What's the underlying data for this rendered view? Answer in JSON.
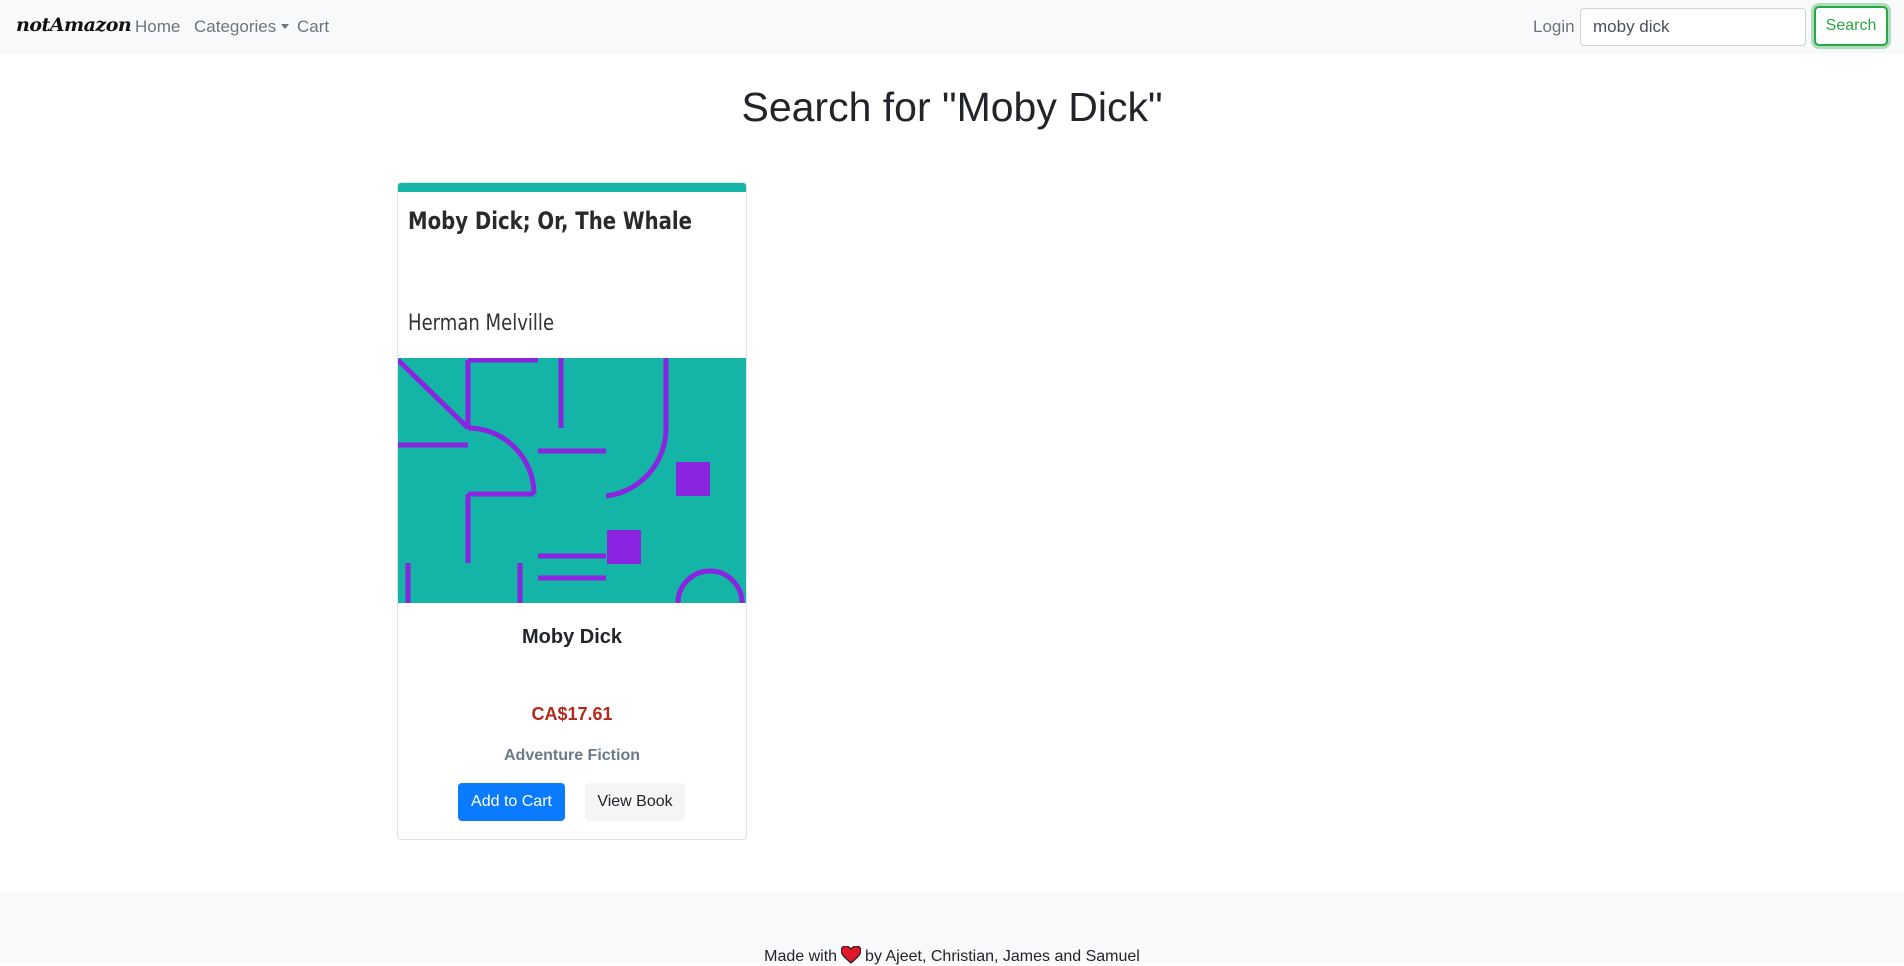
{
  "navbar": {
    "brand": "notAmazon",
    "home": "Home",
    "categories": "Categories",
    "cart": "Cart",
    "login": "Login",
    "search_value": "moby dick",
    "search_button": "Search"
  },
  "main": {
    "heading": "Search for \"Moby Dick\"",
    "results": [
      {
        "cover_title": "Moby Dick; Or, The Whale",
        "cover_author": "Herman Melville",
        "title": "Moby Dick",
        "price": "CA$17.61",
        "genre": "Adventure Fiction",
        "add_button": "Add to Cart",
        "view_button": "View Book"
      }
    ]
  },
  "footer": {
    "prefix": "Made with",
    "heart_icon": "heart-icon",
    "suffix": "by Ajeet, Christian, James and Samuel"
  },
  "colors": {
    "cover_teal": "#14b4a6",
    "cover_purple": "#8a24e0",
    "primary": "#0a7bff",
    "success": "#28a745",
    "price": "#b22a1e",
    "heart": "#e0162b"
  }
}
